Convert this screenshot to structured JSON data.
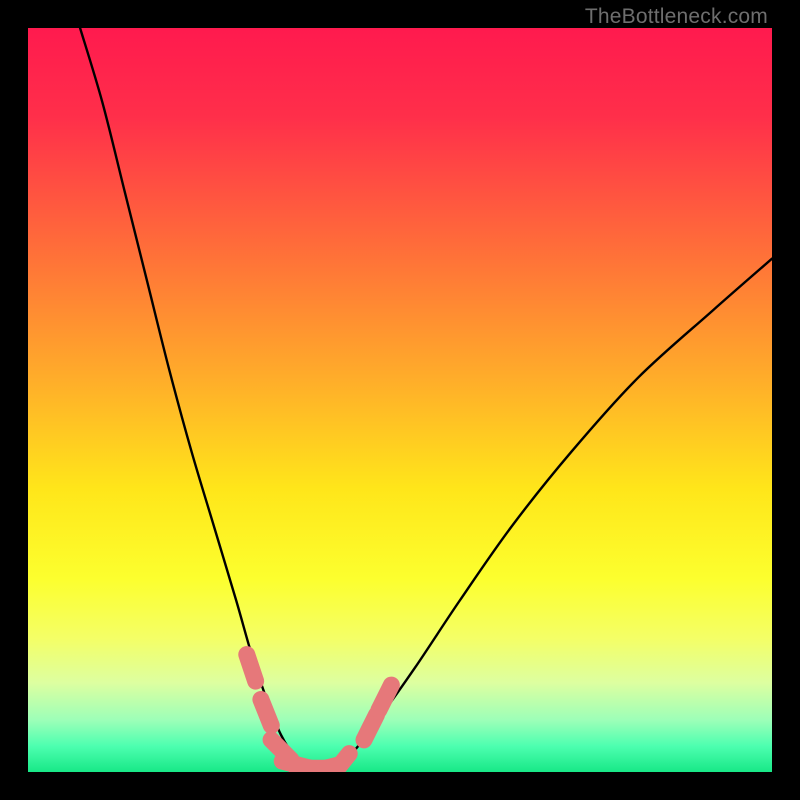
{
  "watermark": "TheBottleneck.com",
  "chart_data": {
    "type": "line",
    "title": "",
    "xlabel": "",
    "ylabel": "",
    "xlim": [
      0,
      100
    ],
    "ylim": [
      0,
      100
    ],
    "series": [
      {
        "name": "bottleneck-curve",
        "x": [
          7,
          10,
          13,
          16,
          19,
          22,
          25,
          28,
          30,
          32,
          34,
          36,
          38,
          40,
          43,
          47,
          52,
          58,
          65,
          73,
          82,
          92,
          100
        ],
        "values": [
          100,
          90,
          78,
          66,
          54,
          43,
          33,
          23,
          16,
          10,
          5,
          2,
          1,
          1,
          2,
          7,
          14,
          23,
          33,
          43,
          53,
          62,
          69
        ]
      }
    ],
    "annotations": [
      {
        "name": "marker-cluster-left",
        "x": 30,
        "y": 14
      },
      {
        "name": "marker-cluster-left2",
        "x": 32,
        "y": 8
      },
      {
        "name": "marker-cluster-left3",
        "x": 34,
        "y": 3
      },
      {
        "name": "marker-valley-1",
        "x": 36,
        "y": 1
      },
      {
        "name": "marker-valley-2",
        "x": 38,
        "y": 0.5
      },
      {
        "name": "marker-valley-3",
        "x": 40,
        "y": 0.5
      },
      {
        "name": "marker-valley-4",
        "x": 42,
        "y": 1
      },
      {
        "name": "marker-cluster-right",
        "x": 46,
        "y": 6
      },
      {
        "name": "marker-cluster-right2",
        "x": 48,
        "y": 10
      }
    ],
    "gradient_stops": [
      {
        "offset": 0.0,
        "color": "#ff1a4e"
      },
      {
        "offset": 0.12,
        "color": "#ff2f4a"
      },
      {
        "offset": 0.3,
        "color": "#ff6f39"
      },
      {
        "offset": 0.48,
        "color": "#ffb029"
      },
      {
        "offset": 0.62,
        "color": "#ffe61a"
      },
      {
        "offset": 0.74,
        "color": "#fcff2e"
      },
      {
        "offset": 0.82,
        "color": "#f4ff66"
      },
      {
        "offset": 0.88,
        "color": "#ddffa0"
      },
      {
        "offset": 0.93,
        "color": "#9dffb8"
      },
      {
        "offset": 0.965,
        "color": "#4dffb0"
      },
      {
        "offset": 1.0,
        "color": "#18e887"
      }
    ],
    "curve_color": "#000000",
    "marker_color": "#e6787a"
  }
}
